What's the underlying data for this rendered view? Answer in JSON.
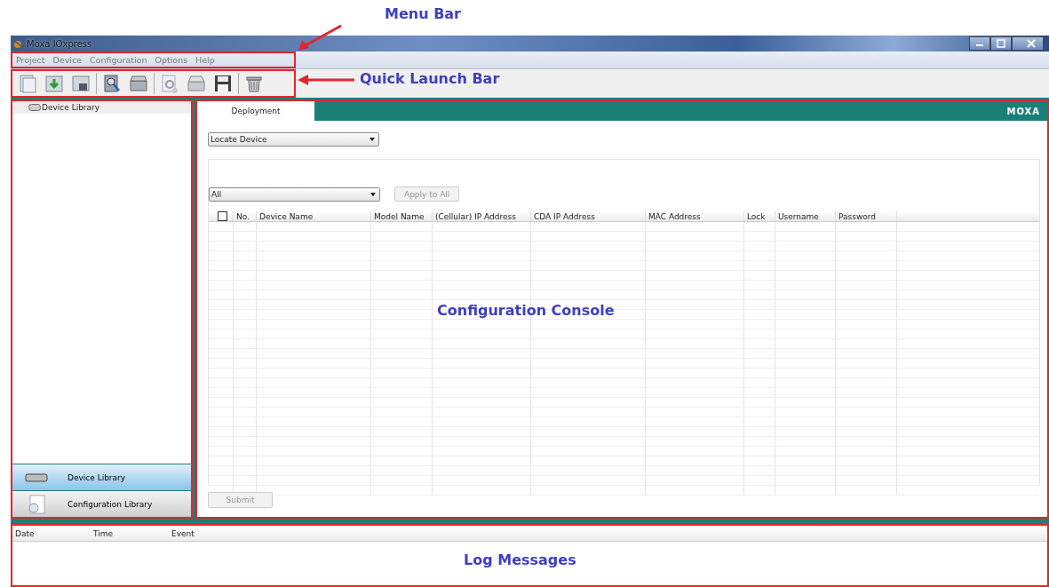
{
  "window": {
    "title": "Moxa IOxpress"
  },
  "menu_bar": [
    "Project",
    "Device",
    "Configuration",
    "Options",
    "Help"
  ],
  "sidebar": {
    "tree": [
      {
        "label": "Device Library"
      }
    ],
    "nav": [
      {
        "label": "Device Library",
        "selected": true
      },
      {
        "label": "Configuration Library",
        "selected": false
      }
    ]
  },
  "tabs": [
    {
      "label": "Deployment",
      "selected": true
    }
  ],
  "brand": "MOXA",
  "locate_dropdown": {
    "value": "Locate Device"
  },
  "filter_dropdown": {
    "value": "All"
  },
  "apply_button": "Apply to All",
  "table": {
    "select_all": {
      "checked": false
    },
    "columns": [
      "No.",
      "Device Name",
      "Model Name",
      "(Cellular) IP Address",
      "CDA IP Address",
      "MAC Address",
      "Lock",
      "Username",
      "Password"
    ]
  },
  "submit_button": "Submit",
  "log": {
    "columns": [
      "Date",
      "Time",
      "Event"
    ]
  },
  "annotations": [
    {
      "text": "Menu Bar"
    },
    {
      "text": "Quick Launch Bar"
    },
    {
      "text": "Configuration Console"
    },
    {
      "text": "Log Messages"
    }
  ]
}
